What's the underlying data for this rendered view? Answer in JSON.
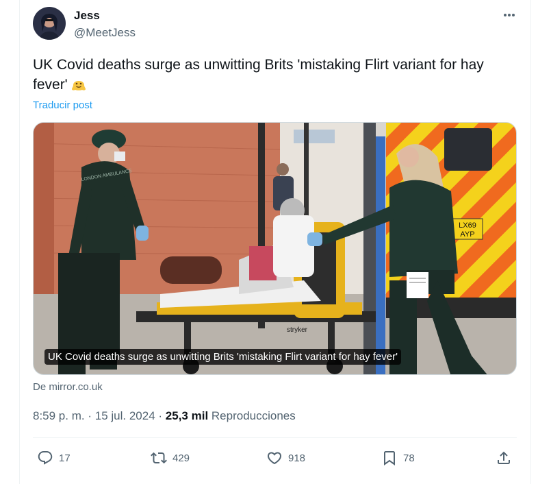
{
  "author": {
    "display_name": "Jess",
    "handle": "@MeetJess"
  },
  "tweet": {
    "text": "UK Covid deaths surge as unwitting Brits 'mistaking Flirt variant for hay fever'",
    "emoji_icon": "melting-face-emoji",
    "translate_label": "Traducir post"
  },
  "media": {
    "caption": "UK Covid deaths surge as unwitting Brits 'mistaking Flirt variant for hay fever'",
    "plate_line1": "LX69",
    "plate_line2": "AYP",
    "jacket_text": "LONDON AMBULANCE",
    "stretcher_brand": "stryker"
  },
  "source": "De mirror.co.uk",
  "meta": {
    "time": "8:59 p. m.",
    "separator": "·",
    "date": "15 jul. 2024",
    "views_count": "25,3 mil",
    "views_label": "Reproducciones"
  },
  "actions": {
    "replies": "17",
    "reposts": "429",
    "likes": "918",
    "bookmarks": "78"
  },
  "colors": {
    "text": "#0f1419",
    "secondary": "#536471",
    "link": "#1d9bf0",
    "border": "#eff3f4"
  }
}
